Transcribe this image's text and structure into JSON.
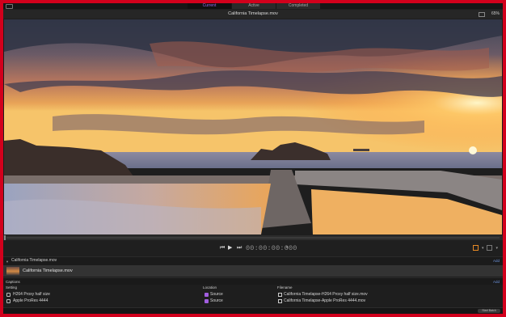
{
  "tabs": [
    {
      "label": "Current",
      "active": true
    },
    {
      "label": "Active",
      "active": false
    },
    {
      "label": "Completed",
      "active": false
    }
  ],
  "title": "California Timelapse.mov",
  "zoom": "65%",
  "player": {
    "timecode": "00:00:00:000",
    "prev_icon": "skip-back-icon",
    "play_icon": "play-icon",
    "next_icon": "skip-forward-icon",
    "progress": 0.0
  },
  "batch": {
    "name": "California Timelapse.mov",
    "add_label": "Add"
  },
  "job": {
    "name": "California Timelapse.mov"
  },
  "captions": {
    "label": "Captions",
    "add_label": "Add"
  },
  "table": {
    "headers": {
      "setting": "Setting",
      "location": "Location",
      "filename": "Filename"
    },
    "rows": [
      {
        "setting": "H264 Proxy half size",
        "location": "Source",
        "filename": "California Timelapse-H264 Proxy half size.mov"
      },
      {
        "setting": "Apple ProRes 4444",
        "location": "Source",
        "filename": "California Timelapse-Apple ProRes 4444.mov"
      }
    ]
  },
  "start_label": "Start Batch",
  "colors": {
    "accent": "#9b6cf0",
    "border": "#d2001c",
    "tool": "#e88a25",
    "folder": "#a25ee0"
  }
}
